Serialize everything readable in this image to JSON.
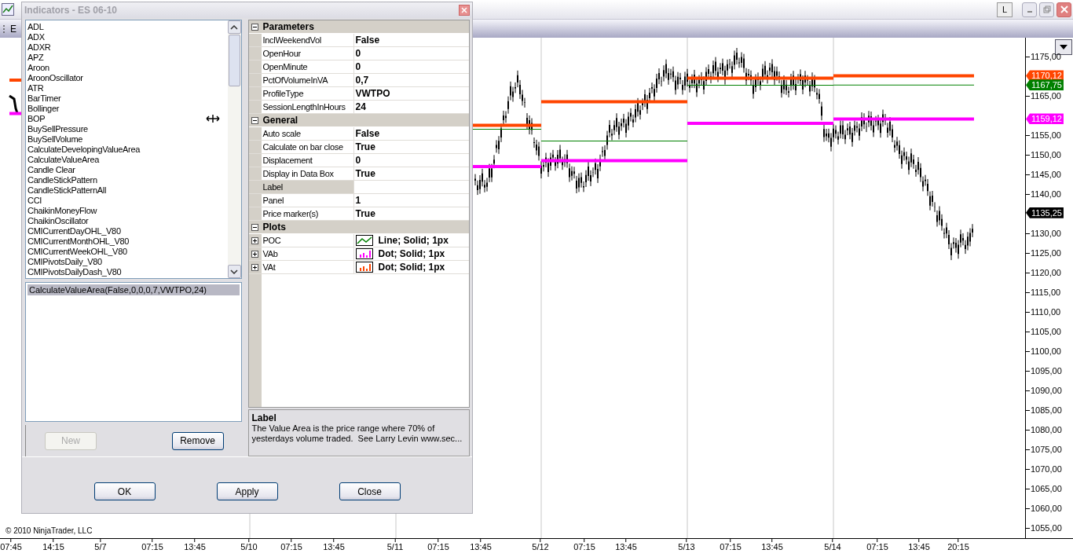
{
  "window": {
    "buttons": {
      "layout": "L"
    },
    "toolbar_text": "E"
  },
  "dialog": {
    "title": "Indicators - ES 06-10",
    "indicators": [
      "ADL",
      "ADX",
      "ADXR",
      "APZ",
      "Aroon",
      "AroonOscillator",
      "ATR",
      "BarTimer",
      "Bollinger",
      "BOP",
      "BuySellPressure",
      "BuySellVolume",
      "CalculateDevelopingValueArea",
      "CalculateValueArea",
      "Candle Clear",
      "CandleStickPattern",
      "CandleStickPatternAll",
      "CCI",
      "ChaikinMoneyFlow",
      "ChaikinOscillator",
      "CMICurrentDayOHL_V80",
      "CMICurrentMonthOHL_V80",
      "CMICurrentWeekOHL_V80",
      "CMIPivotsDaily_V80",
      "CMIPivotsDailyDash_V80"
    ],
    "applied": [
      {
        "label": "CalculateValueArea(False,0,0,0,7,VWTPO,24)",
        "selected": true
      }
    ],
    "list_buttons": [
      {
        "label": "New",
        "disabled": true
      },
      {
        "label": "Remove",
        "disabled": false
      }
    ],
    "properties": [
      {
        "category": "Parameters",
        "expanded": true,
        "rows": [
          {
            "name": "InclWeekendVol",
            "value": "False",
            "selected": false
          },
          {
            "name": "OpenHour",
            "value": "0",
            "selected": false
          },
          {
            "name": "OpenMinute",
            "value": "0",
            "selected": false
          },
          {
            "name": "PctOfVolumeInVA",
            "value": "0,7",
            "selected": false
          },
          {
            "name": "ProfileType",
            "value": "VWTPO",
            "selected": false
          },
          {
            "name": "SessionLengthInHours",
            "value": "24",
            "selected": false
          }
        ]
      },
      {
        "category": "General",
        "expanded": true,
        "rows": [
          {
            "name": "Auto scale",
            "value": "False",
            "selected": false
          },
          {
            "name": "Calculate on bar close",
            "value": "True",
            "selected": false
          },
          {
            "name": "Displacement",
            "value": "0",
            "selected": false
          },
          {
            "name": "Display in Data Box",
            "value": "True",
            "selected": false
          },
          {
            "name": "Label",
            "selected": true
          },
          {
            "name": "Panel",
            "value": "1",
            "selected": false
          },
          {
            "name": "Price marker(s)",
            "value": "True",
            "selected": false
          }
        ]
      },
      {
        "category": "Plots",
        "expanded": true,
        "rows": [
          {
            "name": "POC",
            "value": "Line; Solid; 1px",
            "expanded": false,
            "kind": "line",
            "color": "#008000",
            "selected": false
          },
          {
            "name": "VAb",
            "value": "Dot; Solid; 1px",
            "expanded": false,
            "kind": "bars",
            "color": "#ff00ff",
            "selected": false
          },
          {
            "name": "VAt",
            "value": "Dot; Solid; 1px",
            "expanded": false,
            "kind": "bars",
            "color": "#ff4500",
            "selected": false
          }
        ]
      }
    ],
    "description": {
      "title": "Label",
      "text": "The Value Area is the price range where 70% of yesterdays volume traded.  See Larry Levin www.sec..."
    },
    "buttons": [
      "OK",
      "Apply",
      "Close"
    ]
  },
  "chart": {
    "price_axis": [
      "1175,00",
      "1165,00",
      "1155,00",
      "1150,00",
      "1145,00",
      "1140,00",
      "1130,00",
      "1125,00",
      "1120,00",
      "1115,00",
      "1110,00",
      "1105,00",
      "1100,00",
      "1095,00",
      "1090,00",
      "1085,00",
      "1080,00",
      "1075,00",
      "1070,00",
      "1065,00",
      "1060,00",
      "1055,00"
    ],
    "price_markers": [
      {
        "text": "1170,12",
        "color": "#ff4500"
      },
      {
        "text": "1167,75",
        "color": "#008000"
      },
      {
        "text": "1159,12",
        "color": "#ff00ff"
      },
      {
        "text": "1135,25",
        "color": "#000000"
      }
    ],
    "time_axis": [
      "07:45",
      "14:15",
      "5/7",
      "07:15",
      "13:45",
      "5/10",
      "07:15",
      "13:45",
      "5/11",
      "07:15",
      "13:45",
      "5/12",
      "07:15",
      "13:45",
      "5/13",
      "07:15",
      "13:45",
      "5/14",
      "07:15",
      "13:45",
      "20:15"
    ],
    "copyright": "© 2010 NinjaTrader, LLC"
  }
}
